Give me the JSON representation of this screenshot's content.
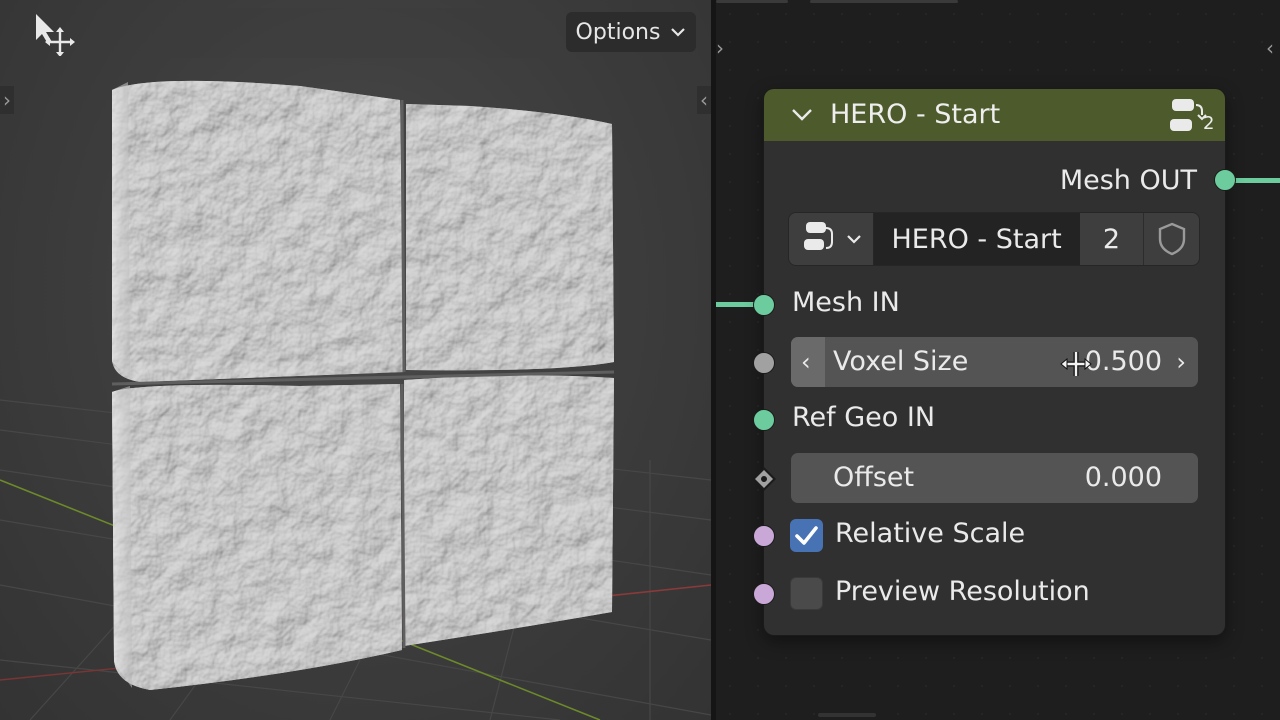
{
  "viewport": {
    "options_label": "Options",
    "tool_icon": "move-cursor-icon"
  },
  "node": {
    "title": "HERO - Start",
    "header_color": "#4d5a2b",
    "user_count_badge": "2",
    "output_socket_label": "Mesh OUT",
    "group_selector": {
      "name": "HERO - Start",
      "users": "2",
      "type_icon": "node-tree-icon",
      "fake_user_icon": "shield-icon"
    },
    "inputs": {
      "mesh_in_label": "Mesh IN",
      "voxel_size_label": "Voxel Size",
      "voxel_size_value": "0.500",
      "ref_geo_label": "Ref Geo IN",
      "offset_label": "Offset",
      "offset_value": "0.000",
      "relative_scale_label": "Relative Scale",
      "relative_scale_checked": true,
      "preview_resolution_label": "Preview Resolution",
      "preview_resolution_checked": false
    }
  },
  "colors": {
    "geometry_socket": "#6ccc9e",
    "float_socket": "#a1a1a1",
    "bool_socket": "#c9a8d8",
    "checkbox_on": "#4772b3"
  }
}
